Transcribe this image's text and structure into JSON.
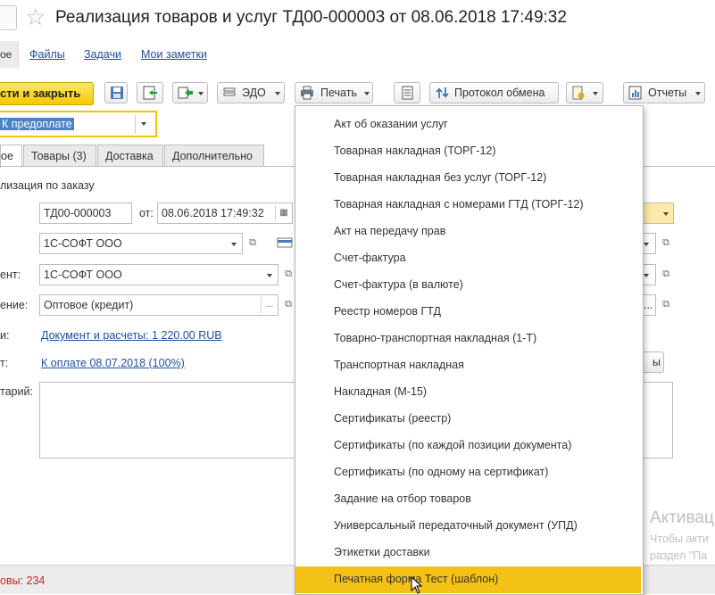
{
  "window": {
    "title": "Реализация товаров и услуг ТД00-000003 от 08.06.2018 17:49:32"
  },
  "nav": {
    "active_label": "ое",
    "links": [
      "Файлы",
      "Задачи",
      "Мои заметки"
    ]
  },
  "toolbar": {
    "primary_label": "сти и закрыть",
    "edo_label": "ЭДО",
    "print_label": "Печать",
    "exchange_log_label": "Протокол обмена",
    "reports_label": "Отчеты"
  },
  "selector": {
    "value": "К предоплате"
  },
  "tabs": [
    "ое",
    "Товары (3)",
    "Доставка",
    "Дополнительно"
  ],
  "form": {
    "order_label": "лизация по заказу",
    "number_value": "ТД00-000003",
    "date_label": "от:",
    "date_value": "08.06.2018 17:49:32",
    "org_value": "1С-СОФТ ООО",
    "counterparty_label": "ент:",
    "counterparty_value": "1С-СОФТ ООО",
    "agreement_label": "ение:",
    "agreement_value": "Оптовое (кредит)",
    "docs_label": "и:",
    "docs_link": "Документ и расчеты: 1 220.00 RUB",
    "payment_label": "т:",
    "payment_link_prefix": "К оплате",
    "payment_link_date": "08.07.2018",
    "payment_link_percent": "(100%)",
    "comment_label": "тарий:",
    "right_button_fragment": "ы"
  },
  "print_menu": {
    "items": [
      "Акт об оказании услуг",
      "Товарная накладная (ТОРГ-12)",
      "Товарная накладная без услуг (ТОРГ-12)",
      "Товарная накладная с номерами ГТД (ТОРГ-12)",
      "Акт на передачу прав",
      "Счет-фактура",
      "Счет-фактура (в валюте)",
      "Реестр номеров ГТД",
      "Товарно-транспортная накладная (1-Т)",
      "Транспортная накладная",
      "Накладная (М-15)",
      "Сертификаты (реестр)",
      "Сертификаты (по каждой позиции документа)",
      "Сертификаты (по одному на сертификат)",
      "Задание на отбор товаров",
      "Универсальный передаточный документ (УПД)",
      "Этикетки доставки",
      "Печатная форма Тест (шаблон)"
    ],
    "highlighted_index": 17,
    "highlight_color": "#f4c116"
  },
  "status": {
    "text": "овы: 234"
  },
  "watermark": {
    "line1": "Активац",
    "line2": "Чтобы акти",
    "line3": "раздел \"Па"
  }
}
